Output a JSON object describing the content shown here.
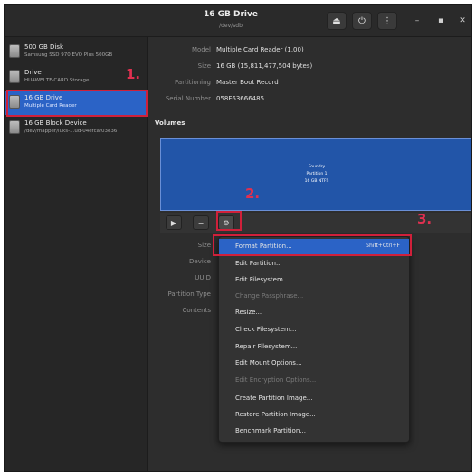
{
  "header": {
    "title": "16 GB Drive",
    "subtitle": "/dev/sdb",
    "buttons": [
      "eject-icon",
      "power-icon",
      "menu-icon"
    ],
    "window_controls": [
      "minimize-icon",
      "maximize-icon",
      "close-icon"
    ]
  },
  "sidebar": {
    "items": [
      {
        "name": "500 GB Disk",
        "sub": "Samsung SSD 970 EVO Plus 500GB"
      },
      {
        "name": "Drive",
        "sub": "HUAWEI TF-CARD Storage"
      },
      {
        "name": "16 GB Drive",
        "sub": "Multiple Card Reader"
      },
      {
        "name": "16 GB Block Device",
        "sub": "/dev/mapper/luks-...ud-04efcaf03e36"
      }
    ]
  },
  "drive_info": {
    "model_label": "Model",
    "model_value": "Multiple Card Reader (1.00)",
    "size_label": "Size",
    "size_value": "16 GB (15,811,477,504 bytes)",
    "partitioning_label": "Partitioning",
    "partitioning_value": "Master Boot Record",
    "serial_label": "Serial Number",
    "serial_value": "058F63666485"
  },
  "volumes": {
    "heading": "Volumes",
    "partition_line1": "Foundry",
    "partition_line2": "Partition 1",
    "partition_line3": "16 GB NTFS",
    "toolbar": [
      "play-icon",
      "minus-icon",
      "gears-icon"
    ]
  },
  "details": {
    "labels": [
      "Size",
      "Device",
      "UUID",
      "Partition Type",
      "Contents"
    ]
  },
  "menu": {
    "items": [
      {
        "label": "Format Partition...",
        "accel": "Shift+Ctrl+F",
        "highlighted": true,
        "disabled": false
      },
      {
        "label": "Edit Partition...",
        "accel": "",
        "highlighted": false,
        "disabled": false
      },
      {
        "label": "Edit Filesystem...",
        "accel": "",
        "highlighted": false,
        "disabled": false
      },
      {
        "label": "Change Passphrase...",
        "accel": "",
        "highlighted": false,
        "disabled": true
      },
      {
        "label": "Resize...",
        "accel": "",
        "highlighted": false,
        "disabled": false
      },
      {
        "label": "Check Filesystem...",
        "accel": "",
        "highlighted": false,
        "disabled": false
      },
      {
        "label": "Repair Filesystem...",
        "accel": "",
        "highlighted": false,
        "disabled": false
      },
      {
        "label": "Edit Mount Options...",
        "accel": "",
        "highlighted": false,
        "disabled": false
      },
      {
        "label": "Edit Encryption Options...",
        "accel": "",
        "highlighted": false,
        "disabled": true
      },
      {
        "label": "Create Partition Image...",
        "accel": "",
        "highlighted": false,
        "disabled": false
      },
      {
        "label": "Restore Partition Image...",
        "accel": "",
        "highlighted": false,
        "disabled": false
      },
      {
        "label": "Benchmark Partition...",
        "accel": "",
        "highlighted": false,
        "disabled": false
      }
    ]
  },
  "annotations": {
    "step1": "1.",
    "step2": "2.",
    "step3": "3.",
    "color": "#d0203a"
  },
  "colors": {
    "accent": "#2b63c6",
    "partition": "#2255a8",
    "background": "#2d2d2d"
  }
}
